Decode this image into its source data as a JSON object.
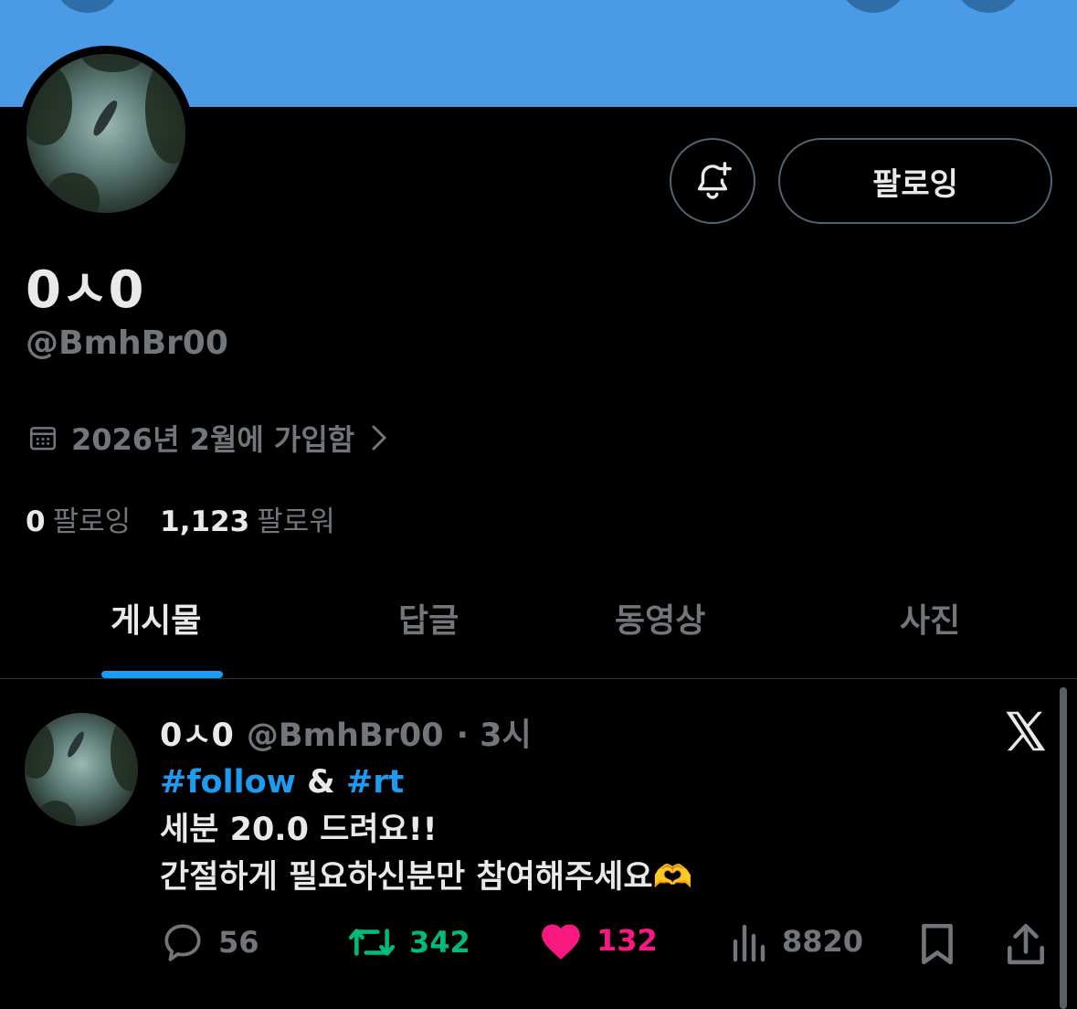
{
  "profile": {
    "display_name": "0ㅅ0",
    "handle": "@BmhBr00",
    "joined": "2026년 2월에 가입함",
    "follow_button": "팔로잉",
    "following_count": "0",
    "following_label": "팔로잉",
    "followers_count": "1,123",
    "followers_label": "팔로워"
  },
  "tabs": [
    {
      "label": "게시물"
    },
    {
      "label": "답글"
    },
    {
      "label": "동영상"
    },
    {
      "label": "사진"
    }
  ],
  "tweet": {
    "name": "0ㅅ0",
    "handle": "@BmhBr00",
    "time": "· 3시",
    "tag1": "#follow",
    "amp": "&",
    "tag2": "#rt",
    "line2": "세분 20.0 드려요!!",
    "line3": "간절하게 필요하신분만 참여해주세요",
    "emoji": "🫶",
    "replies": "56",
    "retweets": "342",
    "likes": "132",
    "views": "8820"
  },
  "colors": {
    "banner": "#4a9ae6",
    "accent": "#1d9bf0",
    "retweet": "#00ba7c",
    "like": "#f91880",
    "muted": "#71767b"
  }
}
